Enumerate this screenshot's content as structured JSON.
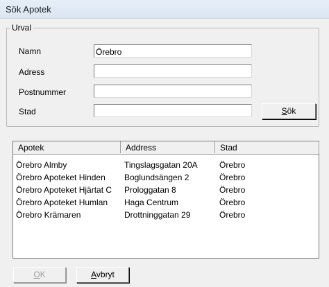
{
  "window": {
    "title": "Sök Apotek"
  },
  "urval": {
    "legend": "Urval",
    "fields": [
      {
        "label": "Namn",
        "value": "Örebro"
      },
      {
        "label": "Adress",
        "value": ""
      },
      {
        "label": "Postnummer",
        "value": ""
      },
      {
        "label": "Stad",
        "value": ""
      }
    ],
    "search_button": {
      "accel": "S",
      "rest": "ök"
    }
  },
  "results": {
    "columns": [
      "Apotek",
      "Address",
      "Stad"
    ],
    "rows": [
      [
        "Örebro Almby",
        "Tingslagsgatan 20A",
        "Örebro"
      ],
      [
        "Örebro Apoteket Hinden",
        "Boglundsängen 2",
        "Örebro"
      ],
      [
        "Örebro Apoteket Hjärtat C",
        "Prologgatan 8",
        "Örebro"
      ],
      [
        "Örebro Apoteket Humlan",
        "Haga Centrum",
        "Örebro"
      ],
      [
        "Örebro Krämaren",
        "Drottninggatan 29",
        "Örebro"
      ]
    ]
  },
  "buttons": {
    "ok": {
      "accel": "O",
      "rest": "K",
      "enabled": false
    },
    "cancel": {
      "accel": "A",
      "rest": "vbryt",
      "enabled": true
    }
  }
}
